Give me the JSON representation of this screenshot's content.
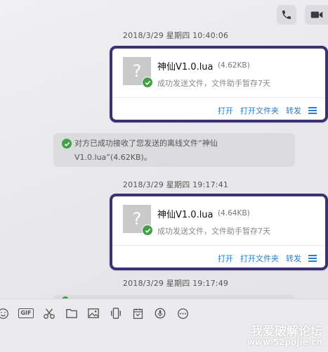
{
  "header": {
    "voice_call": "phone-icon",
    "video_call": "video-camera-icon"
  },
  "messages": [
    {
      "timestamp": "2018/3/29 星期四 10:40:06",
      "file": {
        "name": "神仙V1.0.lua",
        "size": "(4.62KB)",
        "status": "成功发送文件，文件助手暂存7天",
        "actions": [
          "打开",
          "打开文件夹",
          "转发"
        ]
      }
    },
    {
      "timestamp": "2018/3/29 星期四 19:17:41",
      "file": {
        "name": "神仙V1.0.lua",
        "size": "(4.64KB)",
        "status": "成功发送文件，文件助手暂存7天",
        "actions": [
          "打开",
          "打开文件夹",
          "转发"
        ]
      }
    },
    {
      "timestamp": "2018/3/29 星期四 19:17:49"
    }
  ],
  "system_message": {
    "line1": "对方已成功接收了您发送的离线文件“神仙",
    "line2": "V1.0.lua”(4.62KB)。"
  },
  "toolbar": {
    "items": [
      "emoji-icon",
      "gif-icon",
      "scissors-icon",
      "folder-icon",
      "image-icon",
      "shake-icon",
      "calendar-icon",
      "voice-icon",
      "more-icon"
    ],
    "gif_label": "GIF"
  },
  "watermark": {
    "title": "我爱破解论坛",
    "url": "www.52pojie.cn"
  },
  "colors": {
    "card_border": "#3b3276",
    "link": "#2b7dc9",
    "success": "#43a047"
  }
}
